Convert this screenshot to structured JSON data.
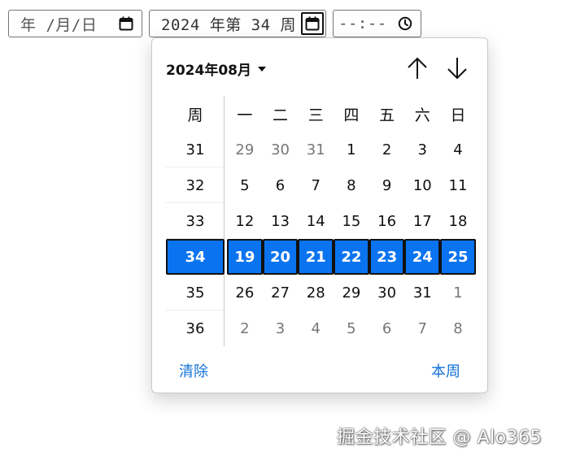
{
  "inputs": {
    "date": {
      "text": "年 /月/日",
      "icon": "calendar-icon"
    },
    "week": {
      "text": "2024 年第 34 周",
      "icon": "calendar-icon"
    },
    "time": {
      "text": "--:--",
      "icon": "clock-icon"
    }
  },
  "picker": {
    "month_label": "2024年08月",
    "week_header": "周",
    "weekday_headers": [
      "一",
      "二",
      "三",
      "四",
      "五",
      "六",
      "日"
    ],
    "selected_week": "34",
    "weeks": [
      {
        "week": "31",
        "days": [
          {
            "d": "29",
            "other": true
          },
          {
            "d": "30",
            "other": true
          },
          {
            "d": "31",
            "other": true
          },
          {
            "d": "1",
            "other": false
          },
          {
            "d": "2",
            "other": false
          },
          {
            "d": "3",
            "other": false
          },
          {
            "d": "4",
            "other": false
          }
        ]
      },
      {
        "week": "32",
        "days": [
          {
            "d": "5",
            "other": false
          },
          {
            "d": "6",
            "other": false
          },
          {
            "d": "7",
            "other": false
          },
          {
            "d": "8",
            "other": false
          },
          {
            "d": "9",
            "other": false
          },
          {
            "d": "10",
            "other": false
          },
          {
            "d": "11",
            "other": false
          }
        ]
      },
      {
        "week": "33",
        "days": [
          {
            "d": "12",
            "other": false
          },
          {
            "d": "13",
            "other": false
          },
          {
            "d": "14",
            "other": false
          },
          {
            "d": "15",
            "other": false
          },
          {
            "d": "16",
            "other": false
          },
          {
            "d": "17",
            "other": false
          },
          {
            "d": "18",
            "other": false
          }
        ]
      },
      {
        "week": "34",
        "days": [
          {
            "d": "19",
            "other": false
          },
          {
            "d": "20",
            "other": false
          },
          {
            "d": "21",
            "other": false
          },
          {
            "d": "22",
            "other": false
          },
          {
            "d": "23",
            "other": false
          },
          {
            "d": "24",
            "other": false
          },
          {
            "d": "25",
            "other": false
          }
        ]
      },
      {
        "week": "35",
        "days": [
          {
            "d": "26",
            "other": false
          },
          {
            "d": "27",
            "other": false
          },
          {
            "d": "28",
            "other": false
          },
          {
            "d": "29",
            "other": false
          },
          {
            "d": "30",
            "other": false
          },
          {
            "d": "31",
            "other": false
          },
          {
            "d": "1",
            "other": true
          }
        ]
      },
      {
        "week": "36",
        "days": [
          {
            "d": "2",
            "other": true
          },
          {
            "d": "3",
            "other": true
          },
          {
            "d": "4",
            "other": true
          },
          {
            "d": "5",
            "other": true
          },
          {
            "d": "6",
            "other": true
          },
          {
            "d": "7",
            "other": true
          },
          {
            "d": "8",
            "other": true
          }
        ]
      }
    ],
    "clear_label": "清除",
    "this_week_label": "本周"
  },
  "colors": {
    "selected_bg": "#0a74f0",
    "link": "#1472d8"
  },
  "watermark": "掘金技术社区 @ Alo365"
}
